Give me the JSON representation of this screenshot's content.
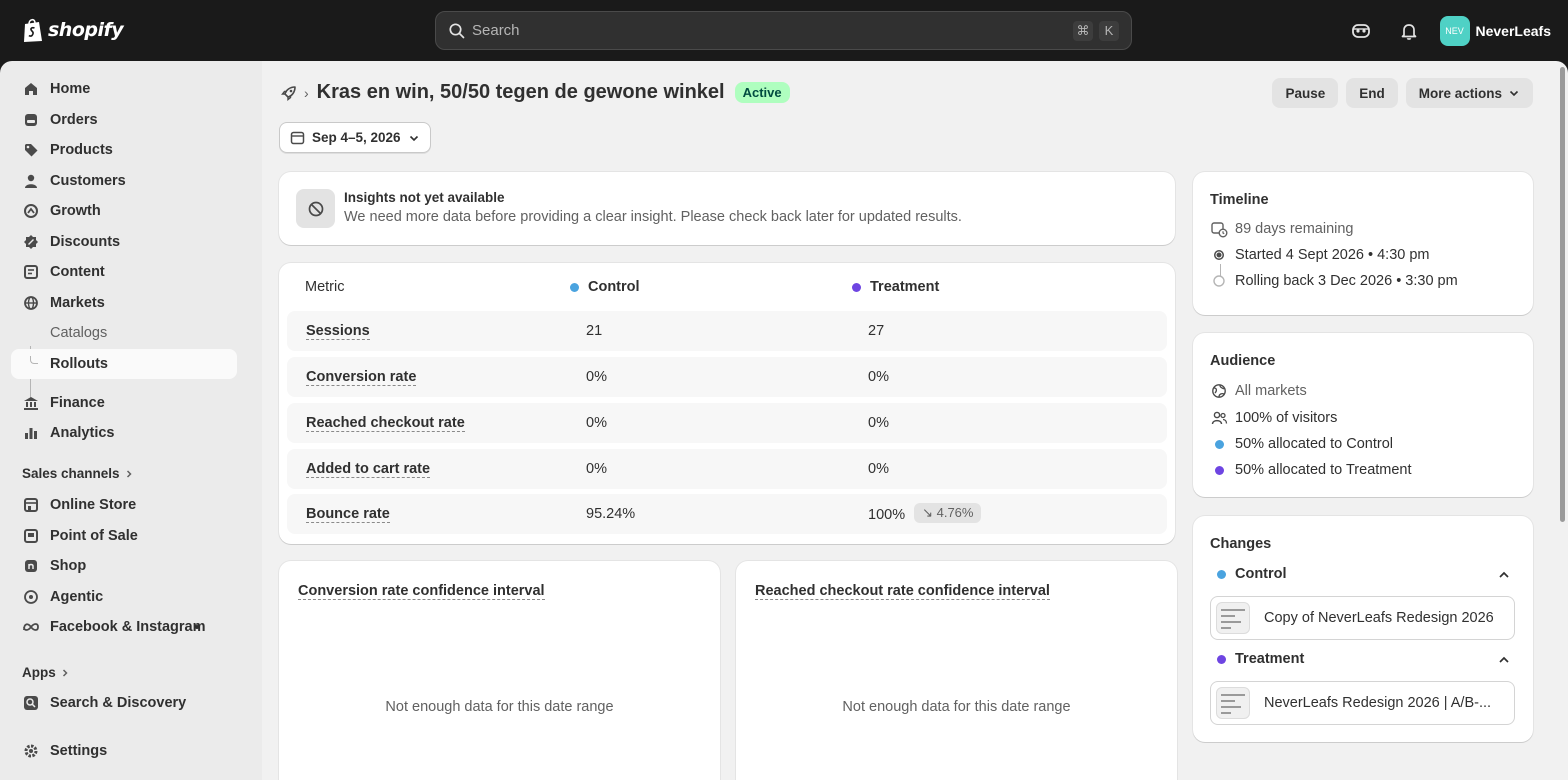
{
  "topbar": {
    "logo_text": "shopify",
    "search_placeholder": "Search",
    "shortcut_cmd": "⌘",
    "shortcut_key": "K",
    "avatar_initials": "NEV",
    "store_name": "NeverLeafs"
  },
  "sidebar": {
    "items": [
      {
        "label": "Home",
        "icon": "home-icon"
      },
      {
        "label": "Orders",
        "icon": "orders-icon"
      },
      {
        "label": "Products",
        "icon": "tag-icon"
      },
      {
        "label": "Customers",
        "icon": "person-icon"
      },
      {
        "label": "Growth",
        "icon": "growth-icon"
      },
      {
        "label": "Discounts",
        "icon": "discount-icon"
      },
      {
        "label": "Content",
        "icon": "content-icon"
      },
      {
        "label": "Markets",
        "icon": "globe-icon"
      }
    ],
    "markets_sub": [
      "Catalogs",
      "Rollouts"
    ],
    "items2": [
      {
        "label": "Finance",
        "icon": "bank-icon"
      },
      {
        "label": "Analytics",
        "icon": "analytics-icon"
      }
    ],
    "sales_channels_label": "Sales channels",
    "channels": [
      {
        "label": "Online Store",
        "icon": "store-icon"
      },
      {
        "label": "Point of Sale",
        "icon": "pos-icon"
      },
      {
        "label": "Shop",
        "icon": "shop-icon"
      },
      {
        "label": "Agentic",
        "icon": "agentic-icon"
      },
      {
        "label": "Facebook & Instagram",
        "icon": "meta-icon"
      }
    ],
    "apps_label": "Apps",
    "apps": [
      {
        "label": "Search & Discovery",
        "icon": "search-discovery-icon"
      }
    ],
    "settings_label": "Settings"
  },
  "header": {
    "title": "Kras en win, 50/50 tegen de gewone winkel",
    "status": "Active",
    "actions": [
      "Pause",
      "End",
      "More actions"
    ],
    "date_range": "Sep 4–5, 2026"
  },
  "insight": {
    "title": "Insights not yet available",
    "text": "We need more data before providing a clear insight. Please check back later for updated results."
  },
  "metrics": {
    "headers": {
      "metric": "Metric",
      "control": "Control",
      "treatment": "Treatment"
    },
    "rows": [
      {
        "name": "Sessions",
        "control": "21",
        "treatment": "27",
        "delta": ""
      },
      {
        "name": "Conversion rate",
        "control": "0%",
        "treatment": "0%",
        "delta": ""
      },
      {
        "name": "Reached checkout rate",
        "control": "0%",
        "treatment": "0%",
        "delta": ""
      },
      {
        "name": "Added to cart rate",
        "control": "0%",
        "treatment": "0%",
        "delta": ""
      },
      {
        "name": "Bounce rate",
        "control": "95.24%",
        "treatment": "100%",
        "delta": "↘ 4.76%"
      }
    ]
  },
  "ci_cards": [
    {
      "title": "Conversion rate confidence interval",
      "empty": "Not enough data for this date range"
    },
    {
      "title": "Reached checkout rate confidence interval",
      "empty": "Not enough data for this date range"
    }
  ],
  "timeline": {
    "title": "Timeline",
    "remaining": "89 days remaining",
    "started": "Started 4 Sept 2026 • 4:30 pm",
    "rollback": "Rolling back 3 Dec 2026 • 3:30 pm"
  },
  "audience": {
    "title": "Audience",
    "markets": "All markets",
    "visitors": "100% of visitors",
    "control": "50% allocated to Control",
    "treatment": "50% allocated to Treatment"
  },
  "changes": {
    "title": "Changes",
    "control_label": "Control",
    "control_theme": "Copy of NeverLeafs Redesign 2026",
    "treatment_label": "Treatment",
    "treatment_theme": "NeverLeafs Redesign 2026 | A/B-..."
  },
  "colors": {
    "control": "#4aa3df",
    "treatment": "#6e45e2",
    "active_badge_bg": "#affebf"
  }
}
